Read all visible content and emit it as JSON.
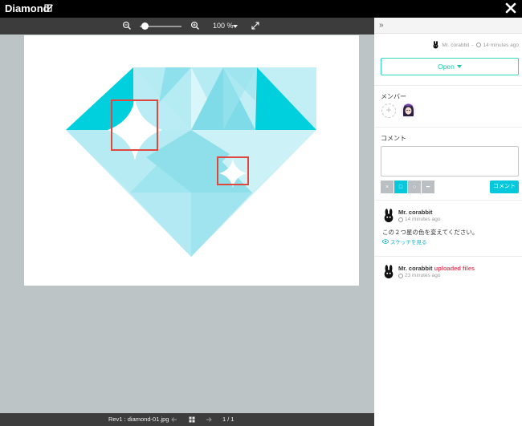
{
  "window": {
    "title": "Diamond"
  },
  "toolbar": {
    "zoom_level": "100 %"
  },
  "footer": {
    "file_name": "Rev1 : diamond-01.jpg",
    "page_count": "1 / 1"
  },
  "panel": {
    "meta": {
      "user": "Mr. corabbit",
      "time": "14 minutes ago"
    },
    "status_button": "Open",
    "members_label": "メンバー",
    "comment_label": "コメント",
    "comment_placeholder": "",
    "comment_button": "コメント",
    "tools": [
      "×",
      "□",
      "○",
      "━"
    ],
    "activity": [
      {
        "author": "Mr. corabbit",
        "time": "14 minutes ago",
        "text": "この２つ星の色を変えてください。",
        "link": "スケッチを見る"
      },
      {
        "author": "Mr. corabbit",
        "action": "uploaded files",
        "time": "23 minutes ago"
      }
    ]
  },
  "colors": {
    "accent": "#05c8dd",
    "status": "#1fc8ad",
    "highlight": "#e9475f"
  }
}
